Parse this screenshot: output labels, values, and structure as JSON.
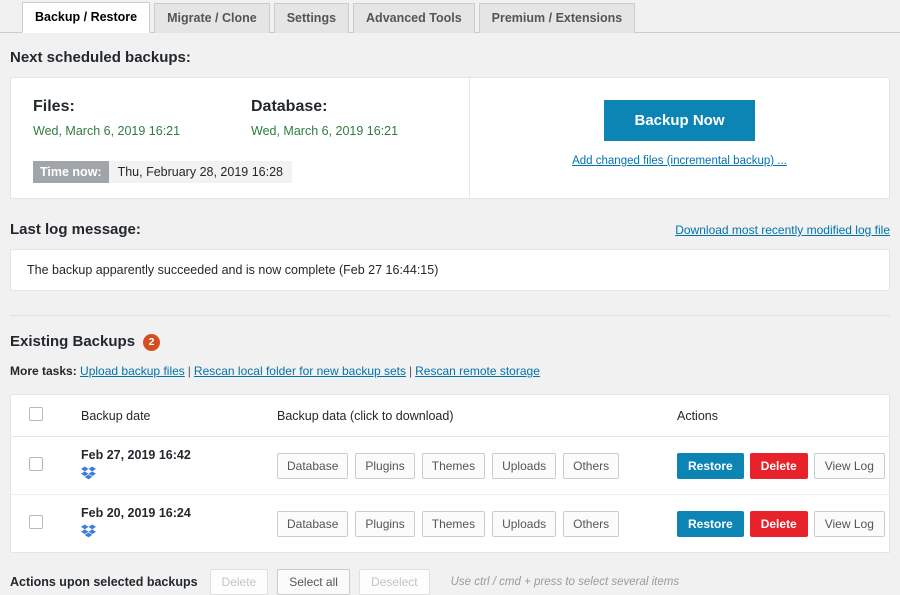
{
  "tabs": [
    {
      "label": "Backup / Restore",
      "active": true
    },
    {
      "label": "Migrate / Clone",
      "active": false
    },
    {
      "label": "Settings",
      "active": false
    },
    {
      "label": "Advanced Tools",
      "active": false
    },
    {
      "label": "Premium / Extensions",
      "active": false
    }
  ],
  "scheduled": {
    "heading": "Next scheduled backups:",
    "files": {
      "title": "Files:",
      "date": "Wed, March 6, 2019 16:21"
    },
    "database": {
      "title": "Database:",
      "date": "Wed, March 6, 2019 16:21"
    },
    "time_now_label": "Time now:",
    "time_now_value": "Thu, February 28, 2019 16:28",
    "backup_now_button": "Backup Now",
    "incremental_link": "Add changed files (incremental backup) ..."
  },
  "log": {
    "heading": "Last log message:",
    "download_link": "Download most recently modified log file",
    "message": "The backup apparently succeeded and is now complete (Feb 27 16:44:15)"
  },
  "existing": {
    "heading": "Existing Backups",
    "count": "2",
    "more_tasks_label": "More tasks:",
    "tasks": [
      "Upload backup files",
      "Rescan local folder for new backup sets",
      "Rescan remote storage"
    ],
    "separator": "|"
  },
  "table": {
    "columns": [
      "Backup date",
      "Backup data (click to download)",
      "Actions"
    ],
    "rows": [
      {
        "date": "Feb 27, 2019 16:42",
        "storage_icon": "dropbox-icon",
        "data_buttons": [
          "Database",
          "Plugins",
          "Themes",
          "Uploads",
          "Others"
        ],
        "actions": [
          "Restore",
          "Delete",
          "View Log"
        ]
      },
      {
        "date": "Feb 20, 2019 16:24",
        "storage_icon": "dropbox-icon",
        "data_buttons": [
          "Database",
          "Plugins",
          "Themes",
          "Uploads",
          "Others"
        ],
        "actions": [
          "Restore",
          "Delete",
          "View Log"
        ]
      }
    ]
  },
  "bulk": {
    "label": "Actions upon selected backups",
    "delete_button": "Delete",
    "select_all_button": "Select all",
    "deselect_button": "Deselect",
    "hint": "Use ctrl / cmd + press to select several items"
  },
  "colors": {
    "primary_blue": "#0c84b4",
    "danger_red": "#e8222a",
    "badge_orange": "#d54e21",
    "schedule_green": "#2f7d42",
    "link_blue": "#0073aa",
    "dropbox_blue": "#3d7ddd"
  }
}
